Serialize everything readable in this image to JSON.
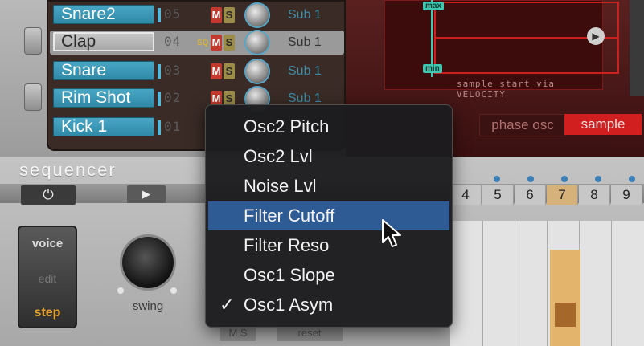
{
  "voices": [
    {
      "name": "Snare2",
      "num": "05",
      "sq": "",
      "output": "Sub 1",
      "selected": false
    },
    {
      "name": "Clap",
      "num": "04",
      "sq": "SQ",
      "output": "Sub 1",
      "selected": true
    },
    {
      "name": "Snare",
      "num": "03",
      "sq": "",
      "output": "Sub 1",
      "selected": false
    },
    {
      "name": "Rim Shot",
      "num": "02",
      "sq": "",
      "output": "Sub 1",
      "selected": false
    },
    {
      "name": "Kick 1",
      "num": "01",
      "sq": "",
      "output": "",
      "selected": false
    }
  ],
  "mute_label": "M",
  "solo_label": "S",
  "display": {
    "max_label": "max",
    "min_label": "min",
    "caption": "sample start via VELOCITY",
    "mode_phase": "phase osc",
    "mode_sample": "sample",
    "accent": "#c92020"
  },
  "sequencer": {
    "title": "sequencer",
    "power_icon": "power-icon",
    "play_icon": "play-icon",
    "modes": {
      "voice": "voice",
      "edit": "edit",
      "step": "step"
    },
    "swing_label": "swing",
    "steps": [
      "4",
      "5",
      "6",
      "7",
      "8",
      "9"
    ],
    "current_step": "7",
    "bottom_ms": "M S",
    "bottom_reset": "reset"
  },
  "menu": {
    "items": [
      {
        "label": "Osc2 Pitch",
        "checked": false,
        "highlighted": false
      },
      {
        "label": "Osc2 Lvl",
        "checked": false,
        "highlighted": false
      },
      {
        "label": "Noise Lvl",
        "checked": false,
        "highlighted": false
      },
      {
        "label": "Filter Cutoff",
        "checked": false,
        "highlighted": true
      },
      {
        "label": "Filter Reso",
        "checked": false,
        "highlighted": false
      },
      {
        "label": "Osc1 Slope",
        "checked": false,
        "highlighted": false
      },
      {
        "label": "Osc1 Asym",
        "checked": true,
        "highlighted": false
      }
    ],
    "check_glyph": "✓",
    "highlight_color": "#2f5b95"
  }
}
